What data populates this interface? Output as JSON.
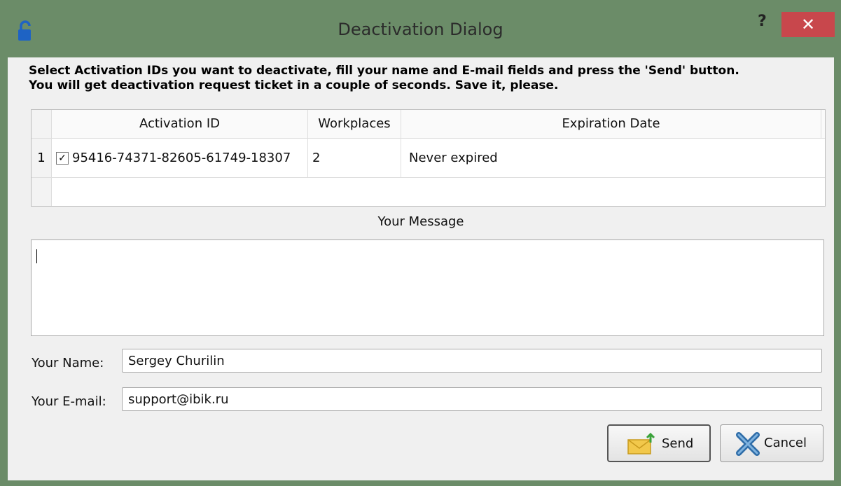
{
  "window": {
    "title": "Deactivation Dialog",
    "help_label": "?",
    "close_label": "✕",
    "accent": "#6b8c68",
    "close_color": "#c8474c"
  },
  "instructions": {
    "line1": "Select Activation IDs you want to deactivate, fill your name and E-mail fields and press the 'Send' button.",
    "line2": "You will get deactivation request ticket in a couple of seconds. Save it, please."
  },
  "table": {
    "headers": [
      "Activation ID",
      "Workplaces",
      "Expiration Date"
    ],
    "rows": [
      {
        "num": "1",
        "checked": true,
        "check_mark": "✓",
        "activation_id": "95416-74371-82605-61749-18307",
        "workplaces": "2",
        "expiration": "Never expired"
      }
    ]
  },
  "message": {
    "label": "Your Message",
    "value": ""
  },
  "form": {
    "name_label": "Your Name:",
    "name_value": "Sergey Churilin",
    "email_label": "Your E-mail:",
    "email_value": "support@ibik.ru"
  },
  "buttons": {
    "send_label": "Send",
    "send_icon": "mail-icon",
    "cancel_label": "Cancel",
    "cancel_icon": "x-cancel-icon"
  }
}
